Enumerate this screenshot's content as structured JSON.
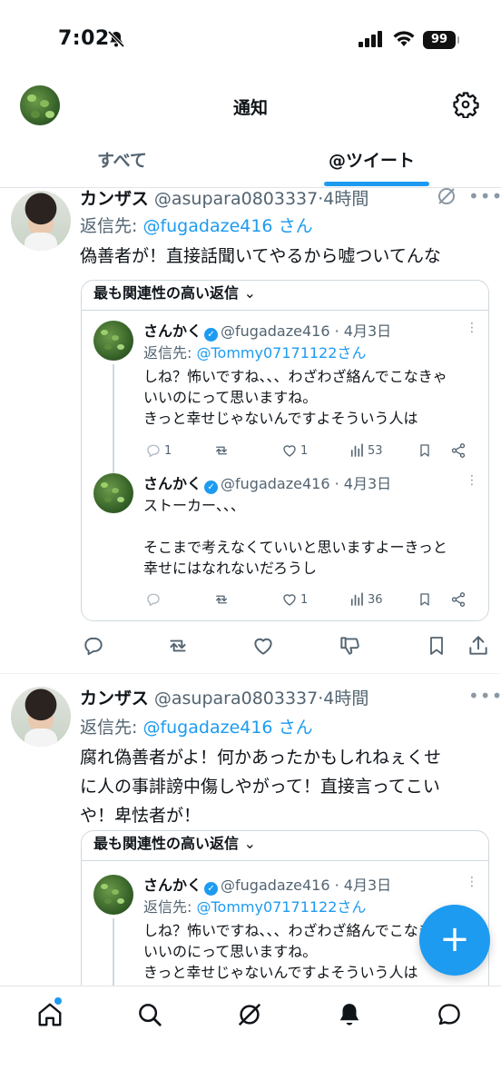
{
  "status_bar": {
    "time": "7:02",
    "battery": "99"
  },
  "header": {
    "title": "通知"
  },
  "tabs": [
    {
      "label": "すべて"
    },
    {
      "label": "@ツイート"
    }
  ],
  "tweets": [
    {
      "name": "カンザス",
      "handle": "@asupara0803337",
      "dot": "·",
      "time": "4時間",
      "reply_prefix": "返信先: ",
      "reply_handle": "@fugadaze416",
      "reply_suffix": " さん",
      "text": "偽善者が！直接話聞いてやるから嘘ついてんな",
      "thread_label": "最も関連性の高い返信",
      "thread_chevron": "⌄",
      "replies": [
        {
          "name": "さんかく",
          "handle": "@fugadaze416",
          "dot": "·",
          "date": "4月3日",
          "reply_prefix": "返信先: ",
          "reply_handle": "@Tommy07171122",
          "reply_suffix": "さん",
          "text": "しね？怖いですね、、、わざわざ絡んでこなきゃ\nいいのにって思いますね。\nきっと幸せじゃないんですよそういう人は",
          "reply_count": "1",
          "like_count": "1",
          "view_count": "53"
        },
        {
          "name": "さんかく",
          "handle": "@fugadaze416",
          "dot": "·",
          "date": "4月3日",
          "text": "ストーカー、、、\n\nそこまで考えなくていいと思いますよーきっと\n幸せにはなれないだろうし",
          "like_count": "1",
          "view_count": "36"
        }
      ]
    },
    {
      "name": "カンザス",
      "handle": "@asupara0803337",
      "dot": "·",
      "time": "4時間",
      "reply_prefix": "返信先: ",
      "reply_handle": "@fugadaze416",
      "reply_suffix": " さん",
      "text": "腐れ偽善者がよ！何かあったかもしれねぇくせ\nに人の事誹謗中傷しやがって！直接言ってこい\nや！卑怯者が！",
      "thread_label": "最も関連性の高い返信",
      "thread_chevron": "⌄",
      "replies": [
        {
          "name": "さんかく",
          "handle": "@fugadaze416",
          "dot": "·",
          "date": "4月3日",
          "reply_prefix": "返信先: ",
          "reply_handle": "@Tommy07171122",
          "reply_suffix": "さん",
          "text": "しね？怖いですね、、、わざわざ絡んでこなきゃ\nいいのにって思いますね。\nきっと幸せじゃないんですよそういう人は"
        }
      ]
    }
  ],
  "fab": {
    "label": "+"
  },
  "colors": {
    "accent": "#1d9bf0",
    "text": "#0f1419",
    "muted": "#536471"
  }
}
